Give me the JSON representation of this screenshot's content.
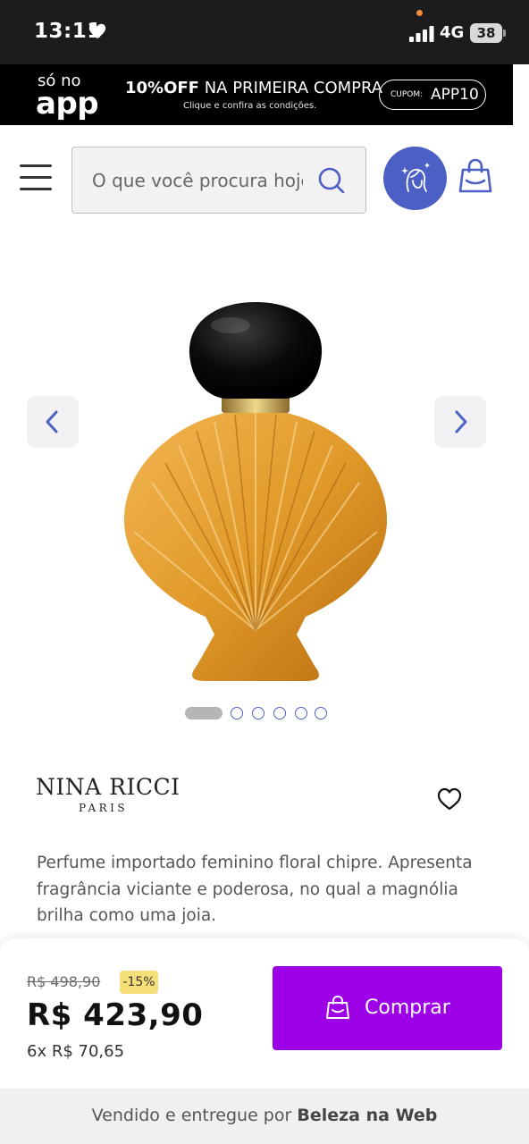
{
  "status_bar": {
    "time": "13:11",
    "network": "4G",
    "battery": "38"
  },
  "promo": {
    "so_no": "só no",
    "app": "app",
    "headline_bold": "10%OFF",
    "headline_rest": " NA PRIMEIRA COMPRA",
    "subtext": "Clique e confira as condições.",
    "coupon_label": "CUPOM:",
    "coupon_code": "APP10"
  },
  "header": {
    "search_placeholder": "O que você procura hoje?"
  },
  "gallery": {
    "image_count": 6,
    "active_index": 0
  },
  "product": {
    "brand_name": "NINA RICCI",
    "brand_sub": "PARIS",
    "description": "Perfume importado feminino floral chipre. Apresenta fragrância viciante e poderosa, no qual a magnólia brilha como uma joia."
  },
  "purchase": {
    "old_price": "R$ 498,90",
    "discount": "-15%",
    "price": "R$ 423,90",
    "installments": "6x R$ 70,65",
    "buy_label": "Comprar",
    "button_color": "#9d00e6"
  },
  "seller": {
    "prefix": "Vendido e entregue por ",
    "name": "Beleza na Web"
  },
  "colors": {
    "accent_blue": "#4c5fc4",
    "discount_badge": "#f6df79"
  }
}
